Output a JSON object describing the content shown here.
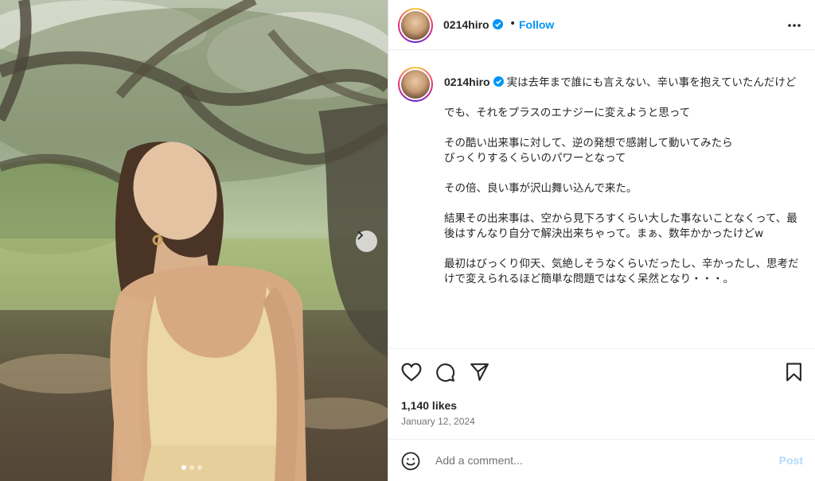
{
  "post": {
    "username": "0214hiro",
    "follow_label": "Follow",
    "bullet": "•",
    "more_icon": "more-horizontal-icon",
    "verified_icon": "verified-badge-icon",
    "caption": "実は去年まで誰にも言えない、辛い事を抱えていたんだけど\n\nでも、それをプラスのエナジーに変えようと思って\n\nその酷い出来事に対して、逆の発想で感謝して動いてみたら\nびっくりするくらいのパワーとなって\n\nその倍、良い事が沢山舞い込んで来た。\n\n結果その出来事は、空から見下ろすくらい大した事ないことなくって、最後はすんなり自分で解決出来ちゃって。まぁ、数年かかったけどw\n\n最初はびっくり仰天、気絶しそうなくらいだったし、辛かったし、思考だけで変えられるほど簡単な問題ではなく呆然となり・・・。",
    "likes": "1,140 likes",
    "date": "January 12, 2024"
  },
  "carousel": {
    "dots": 3,
    "active": 0,
    "next_icon": "chevron-right-icon"
  },
  "actions": {
    "like_icon": "heart-icon",
    "comment_icon": "comment-icon",
    "share_icon": "send-icon",
    "save_icon": "bookmark-icon"
  },
  "comment": {
    "placeholder": "Add a comment...",
    "post_label": "Post",
    "emoji_icon": "emoji-icon"
  },
  "colors": {
    "link": "#0095f6",
    "post_disabled": "#b3dbff",
    "verified": "#0095f6"
  }
}
